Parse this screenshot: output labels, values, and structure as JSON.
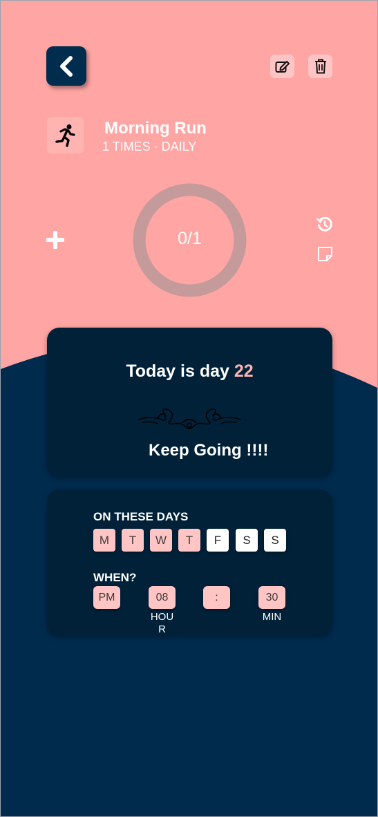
{
  "colors": {
    "pink_bg": "#ffa5a3",
    "navy_bg": "#002b4d",
    "card_bg": "#012139",
    "pill_pink": "#ffc5c5",
    "accent_number": "#ffb3b0"
  },
  "toolbar": {
    "back_icon": "chevron-left-icon",
    "edit_icon": "edit-icon",
    "delete_icon": "trash-icon"
  },
  "habit": {
    "icon": "running-person-icon",
    "title": "Morning Run",
    "frequency": "1 TIMES · DAILY"
  },
  "progress": {
    "label": "0/1",
    "completed": 0,
    "target": 1,
    "add_icon": "plus-icon",
    "undo_icon": "history-icon",
    "note_icon": "note-icon"
  },
  "streak": {
    "prefix": "Today is day",
    "day": "22",
    "flourish_icon": "ornament-flourish-icon",
    "message": "Keep Going !!!!"
  },
  "schedule": {
    "days_label": "ON THESE DAYS",
    "days": [
      {
        "label": "M",
        "active": true
      },
      {
        "label": "T",
        "active": true
      },
      {
        "label": "W",
        "active": true
      },
      {
        "label": "T",
        "active": true
      },
      {
        "label": "F",
        "active": false
      },
      {
        "label": "S",
        "active": false
      },
      {
        "label": "S",
        "active": false
      }
    ],
    "when_label": "WHEN?",
    "ampm": "PM",
    "hour": "08",
    "separator": ":",
    "minute": "30",
    "hour_caption_line1": "HOU",
    "hour_caption_line2": "R",
    "minute_caption": "MIN"
  }
}
